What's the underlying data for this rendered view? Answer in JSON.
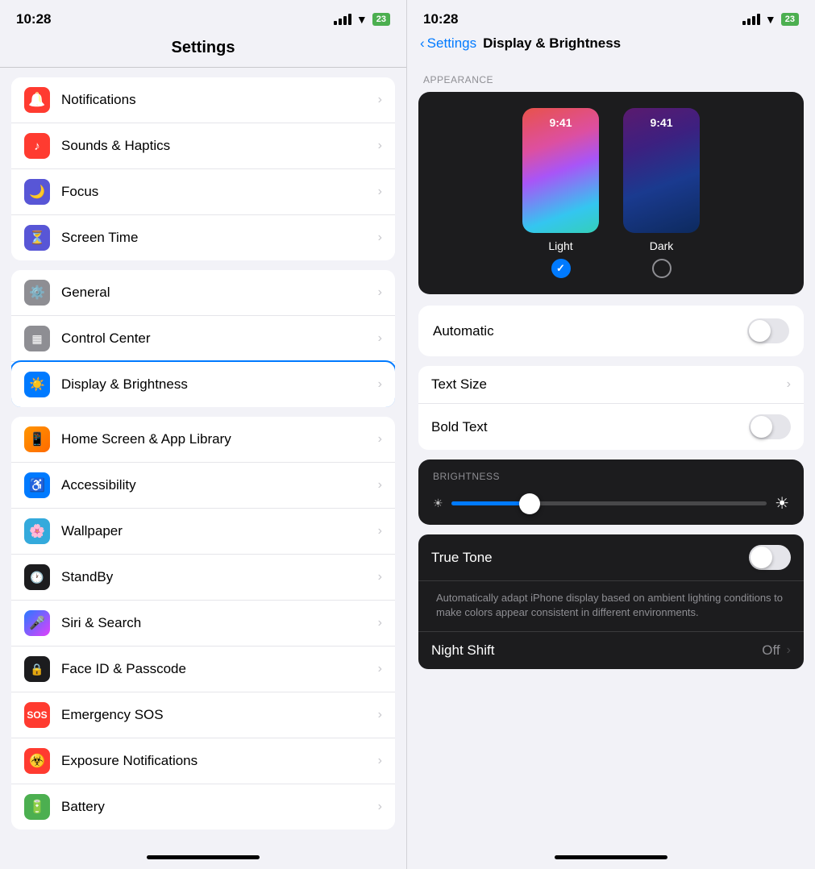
{
  "left": {
    "status": {
      "time": "10:28"
    },
    "title": "Settings",
    "groups": [
      {
        "items": [
          {
            "id": "notifications",
            "label": "Notifications",
            "iconClass": "ic-notifications",
            "iconEmoji": "🔔"
          },
          {
            "id": "sounds",
            "label": "Sounds & Haptics",
            "iconClass": "ic-sounds",
            "iconEmoji": "🔊"
          },
          {
            "id": "focus",
            "label": "Focus",
            "iconClass": "ic-focus",
            "iconEmoji": "🌙"
          },
          {
            "id": "screentime",
            "label": "Screen Time",
            "iconClass": "ic-screentime",
            "iconEmoji": "⏳"
          }
        ]
      },
      {
        "items": [
          {
            "id": "general",
            "label": "General",
            "iconClass": "ic-general",
            "iconEmoji": "⚙️"
          },
          {
            "id": "controlcenter",
            "label": "Control Center",
            "iconClass": "ic-controlcenter",
            "iconEmoji": "🎛"
          },
          {
            "id": "displaybrightness",
            "label": "Display & Brightness",
            "iconClass": "ic-displaybrightness",
            "iconEmoji": "☀️",
            "active": true
          }
        ]
      },
      {
        "items": [
          {
            "id": "homescreen",
            "label": "Home Screen & App Library",
            "iconClass": "ic-homescreen",
            "iconEmoji": "📱"
          },
          {
            "id": "accessibility",
            "label": "Accessibility",
            "iconClass": "ic-accessibility",
            "iconEmoji": "♿"
          },
          {
            "id": "wallpaper",
            "label": "Wallpaper",
            "iconClass": "ic-wallpaper",
            "iconEmoji": "🌸"
          },
          {
            "id": "standby",
            "label": "StandBy",
            "iconClass": "ic-standby",
            "iconEmoji": "🕐"
          },
          {
            "id": "siri",
            "label": "Siri & Search",
            "iconClass": "ic-siri",
            "iconEmoji": "🎤"
          },
          {
            "id": "faceid",
            "label": "Face ID & Passcode",
            "iconClass": "ic-faceid",
            "iconEmoji": "🔒"
          },
          {
            "id": "emergencysos",
            "label": "Emergency SOS",
            "iconClass": "ic-emergencysos",
            "iconEmoji": "🆘"
          },
          {
            "id": "exposure",
            "label": "Exposure Notifications",
            "iconClass": "ic-exposure",
            "iconEmoji": "☣️"
          },
          {
            "id": "battery",
            "label": "Battery",
            "iconClass": "ic-battery",
            "iconEmoji": "🔋"
          }
        ]
      }
    ]
  },
  "right": {
    "status": {
      "time": "10:28"
    },
    "backLabel": "Settings",
    "title": "Display & Brightness",
    "sectionAppearance": "APPEARANCE",
    "lightLabel": "Light",
    "darkLabel": "Dark",
    "lightSelected": true,
    "automaticLabel": "Automatic",
    "automaticOn": false,
    "textSizeLabel": "Text Size",
    "boldTextLabel": "Bold Text",
    "boldTextOn": false,
    "sectionBrightness": "BRIGHTNESS",
    "brightnessValue": 25,
    "trueToneLabel": "True Tone",
    "trueToneOn": false,
    "trueToneDescription": "Automatically adapt iPhone display based on ambient lighting conditions to make colors appear consistent in different environments.",
    "nightShiftLabel": "Night Shift",
    "nightShiftValue": "Off"
  }
}
